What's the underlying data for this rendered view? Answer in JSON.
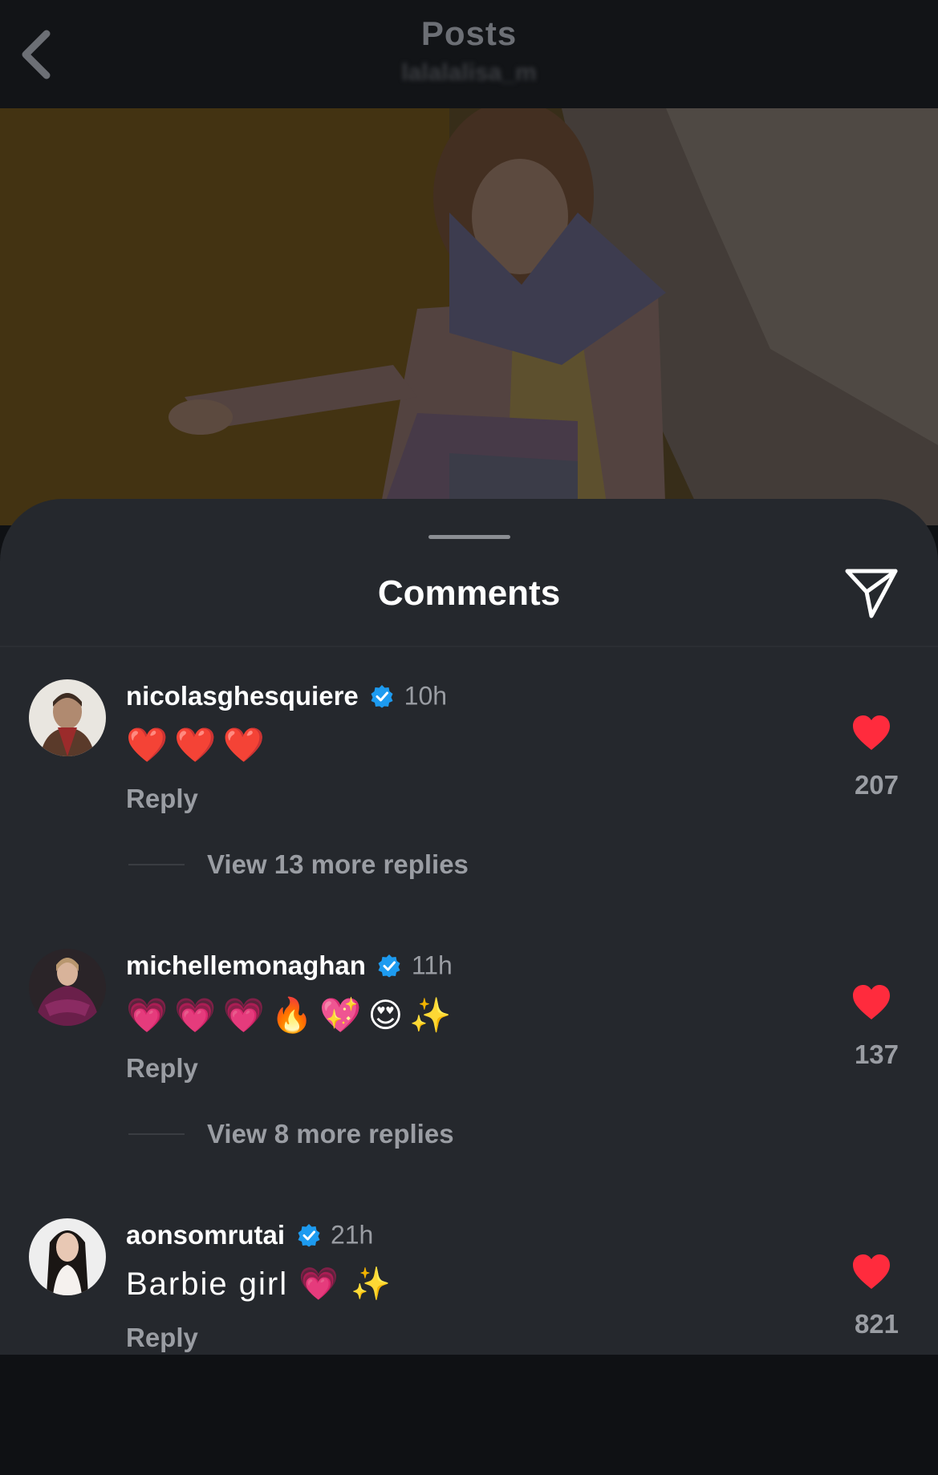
{
  "header": {
    "title": "Posts",
    "subtitle": "lalalalisa_m"
  },
  "sheet": {
    "title": "Comments"
  },
  "comments": [
    {
      "username": "nicolasghesquiere",
      "verified": true,
      "time": "10h",
      "text": "❤️❤️❤️",
      "reply_label": "Reply",
      "likes": "207",
      "view_replies": "View 13 more replies"
    },
    {
      "username": "michellemonaghan",
      "verified": true,
      "time": "11h",
      "text": "💗💗💗🔥💖😍✨",
      "reply_label": "Reply",
      "likes": "137",
      "view_replies": "View 8 more replies"
    },
    {
      "username": "aonsomrutai",
      "verified": true,
      "time": "21h",
      "text": "Barbie girl 💗 ✨",
      "reply_label": "Reply",
      "likes": "821"
    }
  ],
  "colors": {
    "sheet_bg": "#25282d",
    "like_red": "#ff2b3d",
    "verified_blue": "#1d9bf0",
    "secondary_text": "#9a9da3"
  },
  "icons": {
    "back": "chevron-left-icon",
    "share": "paper-plane-icon",
    "like": "heart-icon",
    "verified": "verified-badge-icon"
  }
}
